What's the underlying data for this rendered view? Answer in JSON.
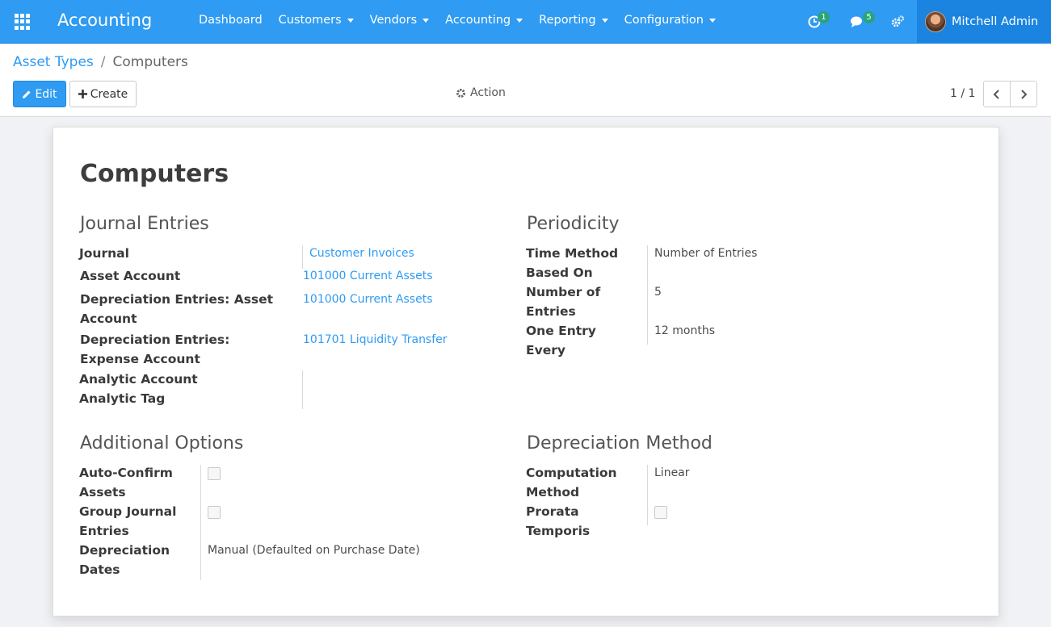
{
  "navbar": {
    "app_name": "Accounting",
    "menu": [
      "Dashboard",
      "Customers",
      "Vendors",
      "Accounting",
      "Reporting",
      "Configuration"
    ],
    "activity_count": "1",
    "message_count": "5",
    "user_name": "Mitchell Admin",
    "accent_color": "#2f9bf2"
  },
  "breadcrumb": {
    "parent": "Asset Types",
    "separator": "/",
    "current": "Computers"
  },
  "toolbar": {
    "edit_label": "Edit",
    "create_label": "Create",
    "action_label": "Action",
    "pager_value": "1 / 1"
  },
  "record": {
    "name": "Computers",
    "journal_entries": {
      "title": "Journal Entries",
      "journal_label": "Journal",
      "journal_value": "Customer Invoices",
      "asset_account_label": "Asset Account",
      "asset_account_value": "101000 Current Assets",
      "dep_asset_label": "Depreciation Entries: Asset Account",
      "dep_asset_value": "101000 Current Assets",
      "dep_expense_label": "Depreciation Entries: Expense Account",
      "dep_expense_value": "101701 Liquidity Transfer",
      "analytic_account_label": "Analytic Account",
      "analytic_tag_label": "Analytic Tag"
    },
    "periodicity": {
      "title": "Periodicity",
      "time_method_label": "Time Method Based On",
      "time_method_value": "Number of Entries",
      "number_entries_label": "Number of Entries",
      "number_entries_value": "5",
      "entry_every_label": "One Entry Every",
      "entry_every_value": "12 months"
    },
    "additional_options": {
      "title": "Additional Options",
      "auto_confirm_label": "Auto-Confirm Assets",
      "auto_confirm_checked": false,
      "group_entries_label": "Group Journal Entries",
      "group_entries_checked": false,
      "dep_dates_label": "Depreciation Dates",
      "dep_dates_value": "Manual (Defaulted on Purchase Date)"
    },
    "depreciation_method": {
      "title": "Depreciation Method",
      "computation_label": "Computation Method",
      "computation_value": "Linear",
      "prorata_label": "Prorata Temporis",
      "prorata_checked": false
    }
  }
}
